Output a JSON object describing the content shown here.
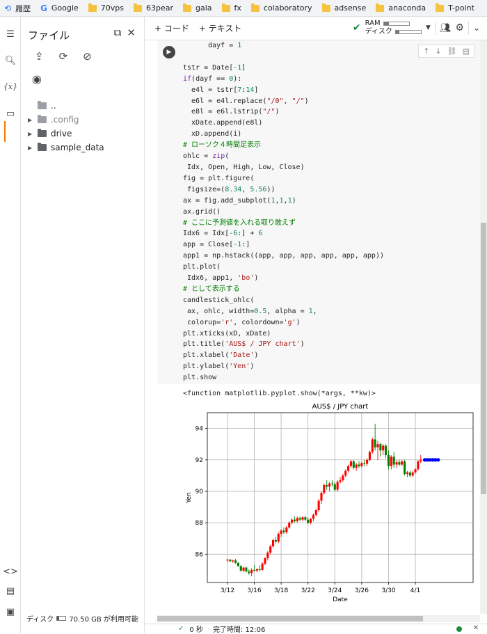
{
  "bookmarks": [
    {
      "label": "履歴",
      "icon": "history-icon"
    },
    {
      "label": "Google",
      "icon": "google-icon"
    },
    {
      "label": "70vps",
      "icon": "folder-icon"
    },
    {
      "label": "63pear",
      "icon": "folder-icon"
    },
    {
      "label": "gala",
      "icon": "folder-icon"
    },
    {
      "label": "fx",
      "icon": "folder-icon"
    },
    {
      "label": "colaboratory",
      "icon": "folder-icon"
    },
    {
      "label": "adsense",
      "icon": "folder-icon"
    },
    {
      "label": "anaconda",
      "icon": "folder-icon"
    },
    {
      "label": "T-point",
      "icon": "folder-icon"
    }
  ],
  "filepanel": {
    "title": "ファイル",
    "tree": [
      {
        "label": "..",
        "type": "parent"
      },
      {
        "label": ".config",
        "type": "folder",
        "dim": true
      },
      {
        "label": "drive",
        "type": "folder"
      },
      {
        "label": "sample_data",
        "type": "folder"
      }
    ],
    "disk_label": "ディスク",
    "disk_fill": 0.25,
    "disk_text": "70.50 GB が利用可能"
  },
  "toolbar": {
    "add_code": "+ コード",
    "add_text": "+ テキスト",
    "ram_label": "RAM",
    "disk_label": "ディスク",
    "ram_fill": 0.2,
    "disk_fill": 0.15
  },
  "output_text": "<function matplotlib.pyplot.show(*args, **kw)>",
  "statusbar": {
    "time_text": "0 秒",
    "completed_text": "完了時間: 12:06"
  },
  "chart_data": {
    "type": "candlestick",
    "title": "AUS$ / JPY chart",
    "xlabel": "Date",
    "ylabel": "Yen",
    "ylim": [
      84.2,
      95.0
    ],
    "xlim": [
      -1.5,
      18.3
    ],
    "yticks": [
      86,
      88,
      90,
      92,
      94
    ],
    "xticks": [
      {
        "pos": 0,
        "label": "3/12"
      },
      {
        "pos": 2,
        "label": "3/16"
      },
      {
        "pos": 4,
        "label": "3/18"
      },
      {
        "pos": 6,
        "label": "3/22"
      },
      {
        "pos": 8,
        "label": "3/24"
      },
      {
        "pos": 10,
        "label": "3/26"
      },
      {
        "pos": 12,
        "label": "3/30"
      },
      {
        "pos": 14,
        "label": "4/1"
      }
    ],
    "grid": true,
    "candles": [
      {
        "x": 0.0,
        "o": 85.6,
        "h": 85.7,
        "l": 85.5,
        "c": 85.65
      },
      {
        "x": 0.2,
        "o": 85.65,
        "h": 85.7,
        "l": 85.5,
        "c": 85.55
      },
      {
        "x": 0.4,
        "o": 85.55,
        "h": 85.65,
        "l": 85.45,
        "c": 85.6
      },
      {
        "x": 0.6,
        "o": 85.6,
        "h": 85.7,
        "l": 85.4,
        "c": 85.45
      },
      {
        "x": 0.8,
        "o": 85.45,
        "h": 85.5,
        "l": 85.2,
        "c": 85.25
      },
      {
        "x": 1.0,
        "o": 85.25,
        "h": 85.3,
        "l": 84.9,
        "c": 84.95
      },
      {
        "x": 1.2,
        "o": 84.95,
        "h": 85.2,
        "l": 84.85,
        "c": 85.15
      },
      {
        "x": 1.4,
        "o": 85.15,
        "h": 85.2,
        "l": 84.85,
        "c": 84.9
      },
      {
        "x": 1.6,
        "o": 84.9,
        "h": 85.05,
        "l": 84.7,
        "c": 84.8
      },
      {
        "x": 1.8,
        "o": 84.8,
        "h": 85.1,
        "l": 84.6,
        "c": 85.0
      },
      {
        "x": 2.0,
        "o": 85.0,
        "h": 85.3,
        "l": 84.9,
        "c": 84.95
      },
      {
        "x": 2.2,
        "o": 84.95,
        "h": 85.1,
        "l": 84.85,
        "c": 85.05
      },
      {
        "x": 2.4,
        "o": 85.05,
        "h": 85.3,
        "l": 84.9,
        "c": 85.0
      },
      {
        "x": 2.6,
        "o": 85.0,
        "h": 85.5,
        "l": 84.95,
        "c": 85.4
      },
      {
        "x": 2.8,
        "o": 85.4,
        "h": 85.8,
        "l": 85.3,
        "c": 85.75
      },
      {
        "x": 3.0,
        "o": 85.75,
        "h": 86.2,
        "l": 85.6,
        "c": 86.1
      },
      {
        "x": 3.2,
        "o": 86.1,
        "h": 86.6,
        "l": 86.0,
        "c": 86.5
      },
      {
        "x": 3.4,
        "o": 86.5,
        "h": 87.0,
        "l": 86.4,
        "c": 86.9
      },
      {
        "x": 3.6,
        "o": 86.9,
        "h": 87.1,
        "l": 86.7,
        "c": 86.8
      },
      {
        "x": 3.8,
        "o": 86.8,
        "h": 87.4,
        "l": 86.7,
        "c": 87.3
      },
      {
        "x": 4.0,
        "o": 87.3,
        "h": 87.6,
        "l": 87.1,
        "c": 87.5
      },
      {
        "x": 4.2,
        "o": 87.5,
        "h": 87.7,
        "l": 87.3,
        "c": 87.4
      },
      {
        "x": 4.4,
        "o": 87.4,
        "h": 87.8,
        "l": 87.3,
        "c": 87.7
      },
      {
        "x": 4.6,
        "o": 87.7,
        "h": 88.1,
        "l": 87.6,
        "c": 88.0
      },
      {
        "x": 4.8,
        "o": 88.0,
        "h": 88.3,
        "l": 87.9,
        "c": 88.2
      },
      {
        "x": 5.0,
        "o": 88.2,
        "h": 88.4,
        "l": 88.0,
        "c": 88.1
      },
      {
        "x": 5.2,
        "o": 88.1,
        "h": 88.4,
        "l": 88.0,
        "c": 88.3
      },
      {
        "x": 5.4,
        "o": 88.3,
        "h": 88.4,
        "l": 88.1,
        "c": 88.2
      },
      {
        "x": 5.6,
        "o": 88.2,
        "h": 88.4,
        "l": 88.1,
        "c": 88.35
      },
      {
        "x": 5.8,
        "o": 88.35,
        "h": 88.45,
        "l": 88.1,
        "c": 88.2
      },
      {
        "x": 6.0,
        "o": 88.2,
        "h": 88.35,
        "l": 87.9,
        "c": 88.0
      },
      {
        "x": 6.2,
        "o": 88.0,
        "h": 88.3,
        "l": 87.9,
        "c": 88.25
      },
      {
        "x": 6.4,
        "o": 88.25,
        "h": 88.6,
        "l": 88.1,
        "c": 88.5
      },
      {
        "x": 6.6,
        "o": 88.5,
        "h": 88.9,
        "l": 88.4,
        "c": 88.8
      },
      {
        "x": 6.8,
        "o": 88.8,
        "h": 89.5,
        "l": 88.7,
        "c": 89.4
      },
      {
        "x": 7.0,
        "o": 89.4,
        "h": 90.0,
        "l": 89.2,
        "c": 89.9
      },
      {
        "x": 7.2,
        "o": 89.9,
        "h": 90.5,
        "l": 89.8,
        "c": 90.4
      },
      {
        "x": 7.4,
        "o": 90.4,
        "h": 90.7,
        "l": 90.1,
        "c": 90.3
      },
      {
        "x": 7.6,
        "o": 90.3,
        "h": 90.6,
        "l": 90.0,
        "c": 90.5
      },
      {
        "x": 7.8,
        "o": 90.5,
        "h": 90.7,
        "l": 90.3,
        "c": 90.45
      },
      {
        "x": 8.0,
        "o": 90.45,
        "h": 90.6,
        "l": 90.0,
        "c": 90.1
      },
      {
        "x": 8.2,
        "o": 90.1,
        "h": 90.7,
        "l": 90.0,
        "c": 90.6
      },
      {
        "x": 8.4,
        "o": 90.6,
        "h": 90.9,
        "l": 90.5,
        "c": 90.7
      },
      {
        "x": 8.6,
        "o": 90.7,
        "h": 91.1,
        "l": 90.6,
        "c": 91.0
      },
      {
        "x": 8.8,
        "o": 91.0,
        "h": 91.4,
        "l": 90.9,
        "c": 91.3
      },
      {
        "x": 9.0,
        "o": 91.3,
        "h": 91.7,
        "l": 91.2,
        "c": 91.6
      },
      {
        "x": 9.2,
        "o": 91.6,
        "h": 92.0,
        "l": 91.5,
        "c": 91.9
      },
      {
        "x": 9.4,
        "o": 91.9,
        "h": 92.0,
        "l": 91.4,
        "c": 91.5
      },
      {
        "x": 9.6,
        "o": 91.5,
        "h": 91.8,
        "l": 91.3,
        "c": 91.7
      },
      {
        "x": 9.8,
        "o": 91.7,
        "h": 91.9,
        "l": 91.5,
        "c": 91.6
      },
      {
        "x": 10.0,
        "o": 91.6,
        "h": 91.9,
        "l": 91.5,
        "c": 91.8
      },
      {
        "x": 10.2,
        "o": 91.8,
        "h": 92.0,
        "l": 91.6,
        "c": 91.75
      },
      {
        "x": 10.4,
        "o": 91.75,
        "h": 92.1,
        "l": 91.6,
        "c": 92.0
      },
      {
        "x": 10.6,
        "o": 92.0,
        "h": 92.6,
        "l": 91.9,
        "c": 92.5
      },
      {
        "x": 10.8,
        "o": 92.5,
        "h": 93.4,
        "l": 92.4,
        "c": 93.3
      },
      {
        "x": 11.0,
        "o": 93.3,
        "h": 94.3,
        "l": 92.6,
        "c": 92.8
      },
      {
        "x": 11.2,
        "o": 92.8,
        "h": 93.2,
        "l": 92.0,
        "c": 93.0
      },
      {
        "x": 11.4,
        "o": 93.0,
        "h": 93.1,
        "l": 92.2,
        "c": 92.6
      },
      {
        "x": 11.6,
        "o": 92.6,
        "h": 93.0,
        "l": 92.3,
        "c": 92.9
      },
      {
        "x": 11.8,
        "o": 92.9,
        "h": 93.0,
        "l": 92.1,
        "c": 92.3
      },
      {
        "x": 12.0,
        "o": 92.3,
        "h": 92.6,
        "l": 91.4,
        "c": 91.6
      },
      {
        "x": 12.2,
        "o": 91.6,
        "h": 92.3,
        "l": 91.4,
        "c": 92.2
      },
      {
        "x": 12.4,
        "o": 92.2,
        "h": 92.5,
        "l": 91.5,
        "c": 91.7
      },
      {
        "x": 12.6,
        "o": 91.7,
        "h": 92.0,
        "l": 91.5,
        "c": 91.85
      },
      {
        "x": 12.8,
        "o": 91.85,
        "h": 92.0,
        "l": 91.6,
        "c": 91.7
      },
      {
        "x": 13.0,
        "o": 91.7,
        "h": 92.0,
        "l": 91.6,
        "c": 91.9
      },
      {
        "x": 13.2,
        "o": 91.9,
        "h": 92.0,
        "l": 91.0,
        "c": 91.1
      },
      {
        "x": 13.4,
        "o": 91.1,
        "h": 91.3,
        "l": 90.9,
        "c": 91.2
      },
      {
        "x": 13.6,
        "o": 91.2,
        "h": 91.3,
        "l": 90.9,
        "c": 91.0
      },
      {
        "x": 13.8,
        "o": 91.0,
        "h": 91.3,
        "l": 90.9,
        "c": 91.2
      },
      {
        "x": 14.0,
        "o": 91.2,
        "h": 91.5,
        "l": 91.1,
        "c": 91.4
      },
      {
        "x": 14.2,
        "o": 91.4,
        "h": 92.0,
        "l": 91.3,
        "c": 91.9
      },
      {
        "x": 14.4,
        "o": 91.9,
        "h": 92.3,
        "l": 91.8,
        "c": 92.0
      }
    ],
    "prediction": {
      "x": [
        14.7,
        14.9,
        15.1,
        15.3,
        15.5,
        15.7
      ],
      "y": [
        92,
        92,
        92,
        92,
        92,
        92
      ]
    },
    "colors": {
      "up": "#ff0000",
      "down": "#008000",
      "prediction": "#0000ff"
    }
  }
}
